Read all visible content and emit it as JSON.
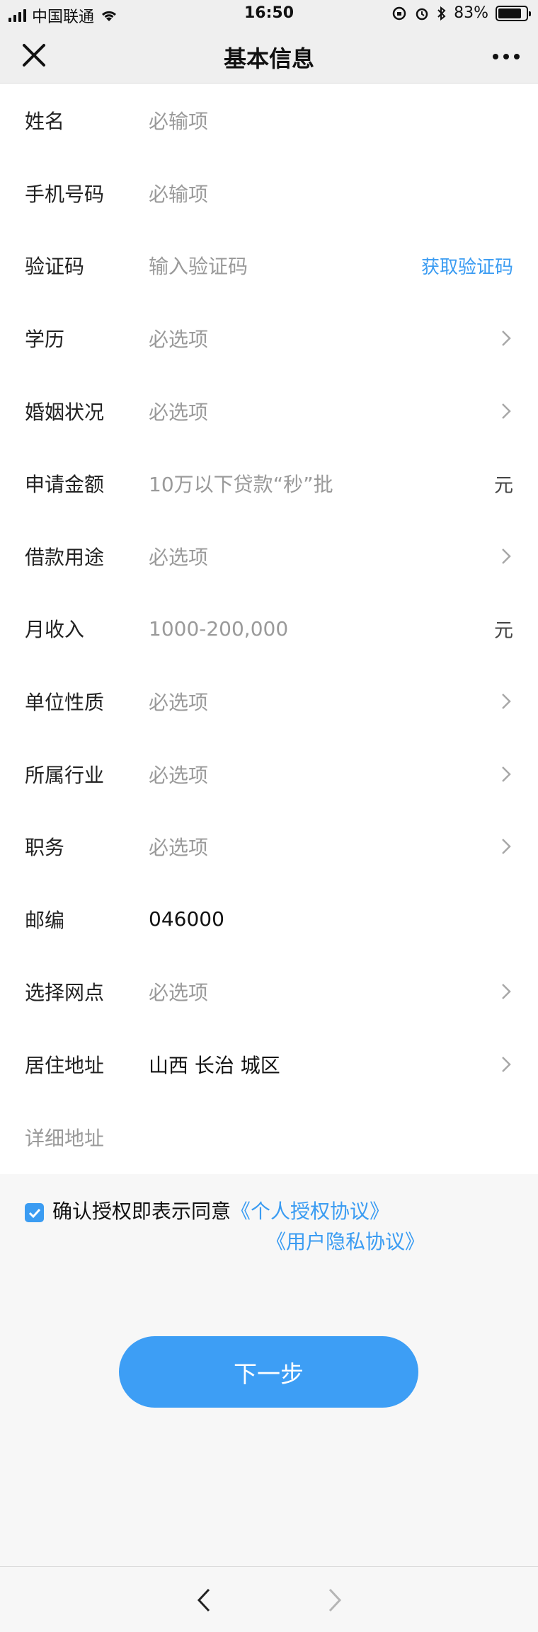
{
  "status_bar": {
    "carrier": "中国联通",
    "time": "16:50",
    "battery_text": "83%",
    "battery_level": 0.83,
    "icons": [
      "signal-icon",
      "wifi-icon",
      "rotation-lock-icon",
      "alarm-icon",
      "bluetooth-icon",
      "battery-icon"
    ]
  },
  "nav": {
    "title": "基本信息",
    "close_icon": "close-icon",
    "more_icon": "more-icon"
  },
  "form": {
    "rows": [
      {
        "label": "姓名",
        "placeholder": "必输项"
      },
      {
        "label": "手机号码",
        "placeholder": "必输项"
      },
      {
        "label": "验证码",
        "placeholder": "输入验证码",
        "link": "获取验证码"
      },
      {
        "label": "学历",
        "placeholder": "必选项"
      },
      {
        "label": "婚姻状况",
        "placeholder": "必选项"
      },
      {
        "label": "申请金额",
        "placeholder": "10万以下贷款“秒”批",
        "suffix": "元"
      },
      {
        "label": "借款用途",
        "placeholder": "必选项"
      },
      {
        "label": "月收入",
        "placeholder": "1000-200,000",
        "suffix": "元"
      },
      {
        "label": "单位性质",
        "placeholder": "必选项"
      },
      {
        "label": "所属行业",
        "placeholder": "必选项"
      },
      {
        "label": "职务",
        "placeholder": "必选项"
      },
      {
        "label": "邮编",
        "value": "046000"
      },
      {
        "label": "选择网点",
        "placeholder": "必选项"
      },
      {
        "label": "居住地址",
        "value": "山西 长治 城区"
      }
    ],
    "detail_address_placeholder": "详细地址"
  },
  "agreement": {
    "checked": true,
    "text": "确认授权即表示同意",
    "link1": "《个人授权协议》",
    "link2": "《用户隐私协议》"
  },
  "next_button": "下一步",
  "toolbar": {
    "back_icon": "chevron-left-icon",
    "forward_icon": "chevron-right-icon"
  },
  "colors": {
    "accent": "#3b9cf2",
    "placeholder": "#9a9a9a",
    "background": "#f7f7f7"
  }
}
